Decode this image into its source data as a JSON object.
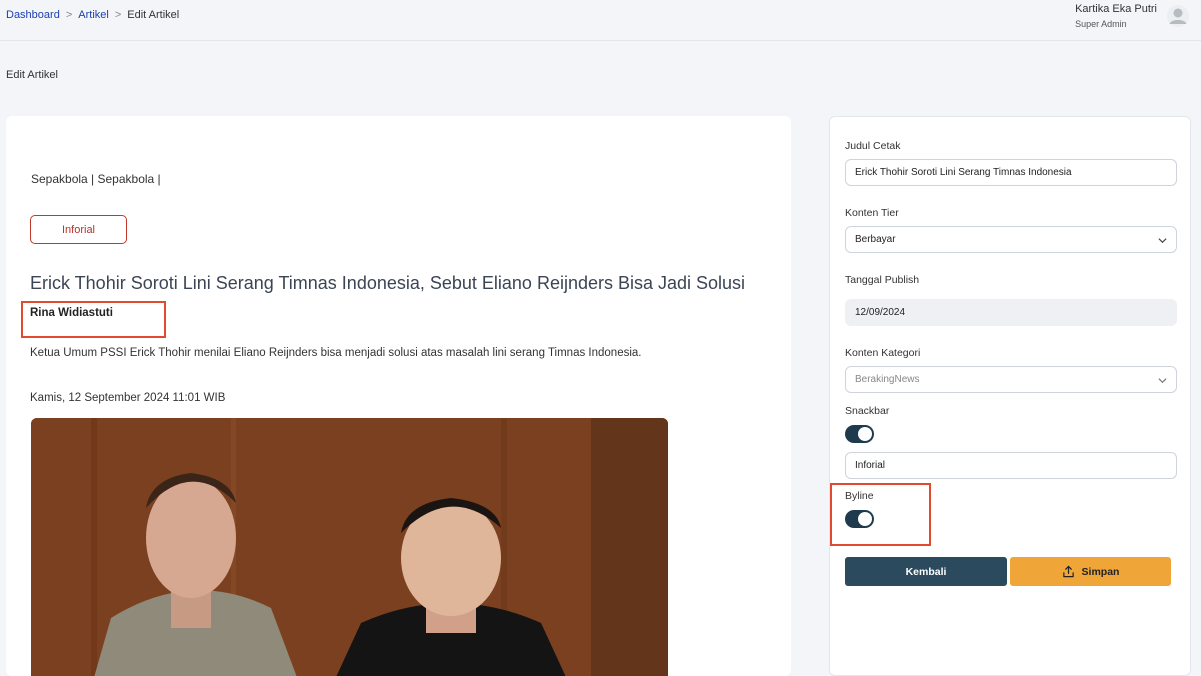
{
  "breadcrumb": {
    "home": "Dashboard",
    "section": "Artikel",
    "current": "Edit Artikel",
    "separator": ">"
  },
  "user": {
    "name": "Kartika Eka Putri",
    "role": "Super Admin"
  },
  "page_title": "Edit Artikel",
  "preview": {
    "categories": "Sepakbola | Sepakbola |",
    "tag": "Inforial",
    "headline": "Erick Thohir Soroti Lini Serang Timnas Indonesia, Sebut Eliano Reijnders Bisa Jadi Solusi",
    "author": "Rina Widiastuti",
    "summary": "Ketua Umum PSSI Erick Thohir menilai Eliano Reijnders bisa menjadi solusi atas masalah lini serang Timnas Indonesia.",
    "date": "Kamis, 12 September 2024 11:01 WIB"
  },
  "form": {
    "judul_cetak_label": "Judul Cetak",
    "judul_cetak_value": "Erick Thohir Soroti Lini Serang Timnas Indonesia",
    "konten_tier_label": "Konten Tier",
    "konten_tier_value": "Berbayar",
    "tanggal_publish_label": "Tanggal Publish",
    "tanggal_publish_value": "12/09/2024",
    "konten_kategori_label": "Konten Kategori",
    "konten_kategori_value": "BerakingNews",
    "snackbar_label": "Snackbar",
    "snackbar_on": true,
    "snackbar_value": "Inforial",
    "byline_label": "Byline",
    "byline_on": true,
    "back_label": "Kembali",
    "save_label": "Simpan"
  },
  "colors": {
    "accent_dark": "#2c4a5e",
    "accent_orange": "#efa537",
    "highlight_red": "#e04a2f",
    "link_blue": "#1e40af"
  }
}
